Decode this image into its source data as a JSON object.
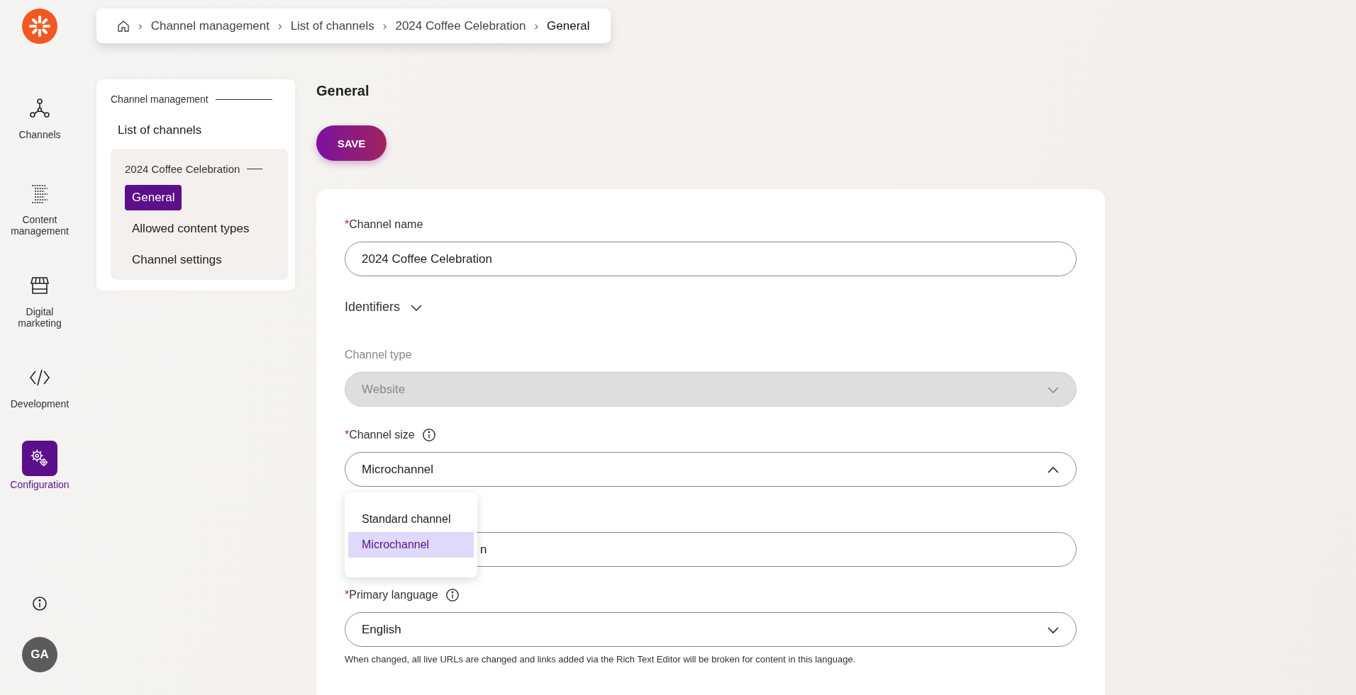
{
  "rail": {
    "items": [
      {
        "kind": "channels",
        "label": "Channels",
        "selected": false
      },
      {
        "kind": "content",
        "label": "Content management",
        "selected": false
      },
      {
        "kind": "store",
        "label": "Digital marketing",
        "selected": false
      },
      {
        "kind": "code",
        "label": "Development",
        "selected": false
      },
      {
        "kind": "gears",
        "label": "Configuration",
        "selected": true
      }
    ],
    "avatar": "GA"
  },
  "breadcrumb": {
    "separator": "›",
    "items": [
      {
        "label": "Channel management",
        "current": false
      },
      {
        "label": "List of channels",
        "current": false
      },
      {
        "label": "2024 Coffee Celebration",
        "current": false
      },
      {
        "label": "General",
        "current": true
      }
    ]
  },
  "subnav": {
    "section": "Channel management",
    "list_link": "List of channels",
    "group": "2024 Coffee Celebration",
    "items": [
      {
        "label": "General",
        "selected": true
      },
      {
        "label": "Allowed content types",
        "selected": false
      },
      {
        "label": "Channel settings",
        "selected": false
      }
    ]
  },
  "page_title": "General",
  "save_button": "SAVE",
  "form": {
    "required_mark": "*",
    "fields": [
      {
        "kind": "text",
        "label": "Channel name",
        "required": true,
        "value": "2024 Coffee Celebration"
      },
      {
        "kind": "expander",
        "label": "Identifiers",
        "expanded": false
      },
      {
        "kind": "select",
        "label": "Channel type",
        "required": false,
        "disabled": true,
        "open": false,
        "value": "Website"
      },
      {
        "kind": "select",
        "label": "Channel size",
        "required": true,
        "info": true,
        "disabled": false,
        "open": true,
        "value": "Microchannel",
        "options": [
          {
            "label": "Standard channel",
            "selected": false
          },
          {
            "label": "Microchannel",
            "selected": true
          }
        ]
      },
      {
        "kind": "covered_text",
        "value": "n"
      },
      {
        "kind": "select",
        "label": "Primary language",
        "required": true,
        "info": true,
        "disabled": false,
        "open": false,
        "value": "English",
        "help": "When changed, all live URLs are changed and links added via the Rich Text Editor will be broken for content in this language."
      }
    ]
  }
}
